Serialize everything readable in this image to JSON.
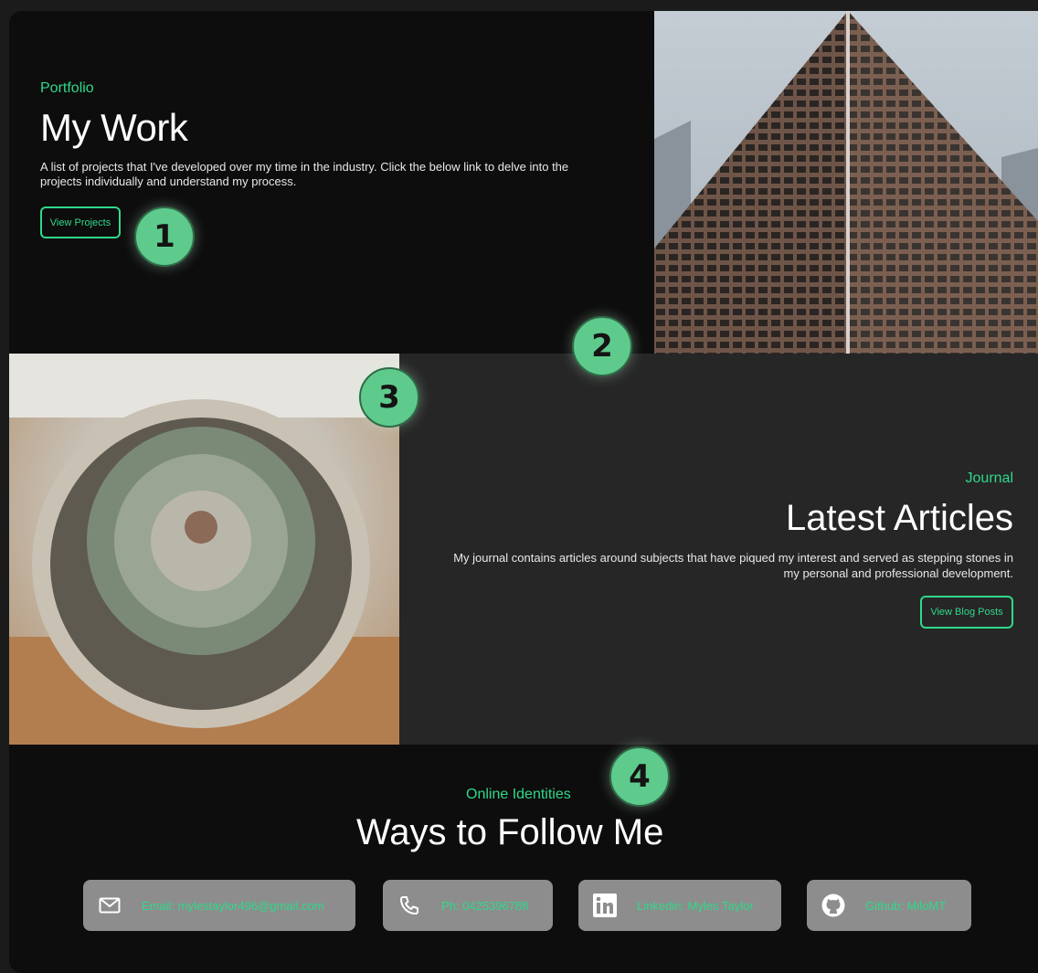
{
  "portfolio": {
    "eyebrow": "Portfolio",
    "title": "My Work",
    "description": "A list of projects that I've developed over my time in the industry. Click the below link to delve into the projects individually and understand my process.",
    "button_label": "View Projects"
  },
  "journal": {
    "eyebrow": "Journal",
    "title": "Latest Articles",
    "description": "My journal contains articles around subjects that have piqued my interest and served as stepping stones in my personal and professional development.",
    "button_label": "View Blog Posts"
  },
  "follow": {
    "eyebrow": "Online Identities",
    "title": "Ways to Follow Me",
    "contacts": [
      {
        "label": "Email: mylestaylor496@gmail.com",
        "icon": "mail-icon"
      },
      {
        "label": "Ph: 0425396788",
        "icon": "phone-icon"
      },
      {
        "label": "Linkedin: Myles Taylor",
        "icon": "linkedin-icon"
      },
      {
        "label": "Github: MiloMT",
        "icon": "github-icon"
      }
    ]
  },
  "markers": [
    "1",
    "2",
    "3",
    "4"
  ],
  "colors": {
    "accent": "#2fd98a",
    "background": "#0d0d0d",
    "panel": "#262626",
    "contact_card": "#8d8d8d",
    "marker": "#5ecb8c"
  }
}
